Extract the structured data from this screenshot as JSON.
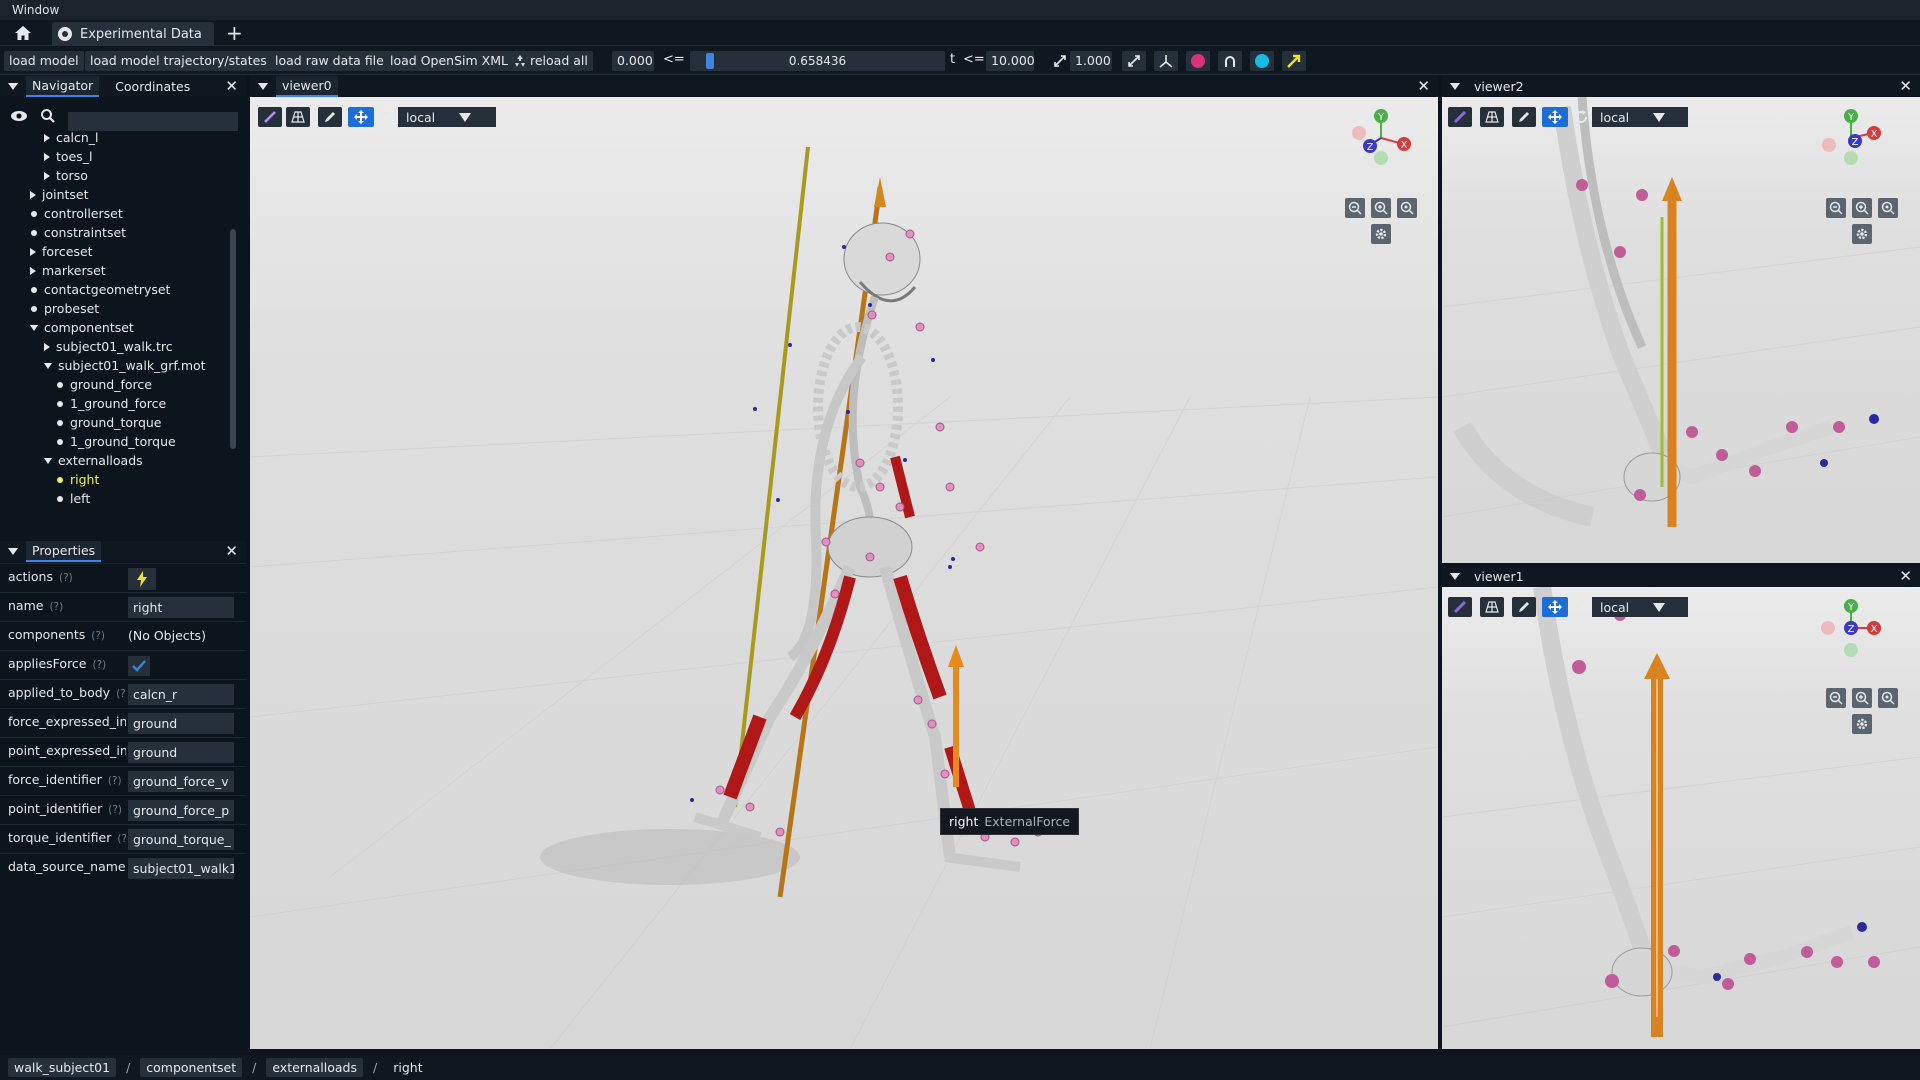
{
  "window": {
    "title": "Window"
  },
  "tabs": [
    {
      "label": "Experimental Data"
    }
  ],
  "toolbar": {
    "load_model": "load model",
    "load_trajectory": "load model trajectory/states",
    "load_raw": "load raw data file",
    "load_xml": "load OpenSim XML",
    "reload_all": "reload all",
    "t_min": "0.000",
    "leq1": "<=",
    "t_value": "0.658436",
    "t_label": "t",
    "leq2": "<=",
    "t_max": "10.000",
    "speed": "1.000"
  },
  "navigator": {
    "tab_navigator": "Navigator",
    "tab_coordinates": "Coordinates",
    "search_placeholder": "",
    "items": [
      {
        "label": "calcn_l",
        "kind": "collapsed"
      },
      {
        "label": "toes_l",
        "kind": "collapsed"
      },
      {
        "label": "torso",
        "kind": "collapsed"
      },
      {
        "label": "jointset",
        "kind": "collapsed"
      },
      {
        "label": "controllerset",
        "kind": "leaf"
      },
      {
        "label": "constraintset",
        "kind": "leaf"
      },
      {
        "label": "forceset",
        "kind": "collapsed"
      },
      {
        "label": "markerset",
        "kind": "collapsed"
      },
      {
        "label": "contactgeometryset",
        "kind": "leaf"
      },
      {
        "label": "probeset",
        "kind": "leaf"
      },
      {
        "label": "componentset",
        "kind": "expanded"
      },
      {
        "label": "subject01_walk.trc",
        "kind": "collapsed"
      },
      {
        "label": "subject01_walk_grf.mot",
        "kind": "expanded"
      },
      {
        "label": "ground_force",
        "kind": "leaf"
      },
      {
        "label": "1_ground_force",
        "kind": "leaf"
      },
      {
        "label": "ground_torque",
        "kind": "leaf"
      },
      {
        "label": "1_ground_torque",
        "kind": "leaf"
      },
      {
        "label": "externalloads",
        "kind": "expanded"
      },
      {
        "label": "right",
        "kind": "leaf-selected"
      },
      {
        "label": "left",
        "kind": "leaf"
      }
    ]
  },
  "properties": {
    "title": "Properties",
    "help_marker": "(?)",
    "rows": [
      {
        "label": "actions",
        "type": "bolt"
      },
      {
        "label": "name",
        "value": "right",
        "type": "field"
      },
      {
        "label": "components",
        "value": "(No Objects)",
        "type": "text"
      },
      {
        "label": "appliesForce",
        "type": "checkbox",
        "checked": true
      },
      {
        "label": "applied_to_body",
        "value": "calcn_r",
        "type": "field"
      },
      {
        "label": "force_expressed_in",
        "value": "ground",
        "type": "field"
      },
      {
        "label": "point_expressed_in",
        "value": "ground",
        "type": "field"
      },
      {
        "label": "force_identifier",
        "value": "ground_force_v",
        "type": "field"
      },
      {
        "label": "point_identifier",
        "value": "ground_force_p",
        "type": "field"
      },
      {
        "label": "torque_identifier",
        "value": "ground_torque_",
        "type": "field"
      },
      {
        "label": "data_source_name",
        "value": "subject01_walk1",
        "type": "field"
      }
    ]
  },
  "viewers": {
    "viewer0": {
      "title": "viewer0",
      "frame": "local"
    },
    "viewer2": {
      "title": "viewer2",
      "frame": "local"
    },
    "viewer1": {
      "title": "viewer1",
      "frame": "local"
    }
  },
  "tooltip": {
    "name": "right",
    "type": "ExternalForce"
  },
  "axes": {
    "x": "X",
    "y": "Y",
    "z": "Z"
  },
  "breadcrumb": [
    "walk_subject01",
    "componentset",
    "externalloads",
    "right"
  ],
  "breadcrumb_sep": "/",
  "colors": {
    "accent": "#3d85e0",
    "selected_text": "#f2f24a",
    "force_arrow": "#e88a1a",
    "muscle": "#b01818",
    "marker": "#e48ec2"
  }
}
